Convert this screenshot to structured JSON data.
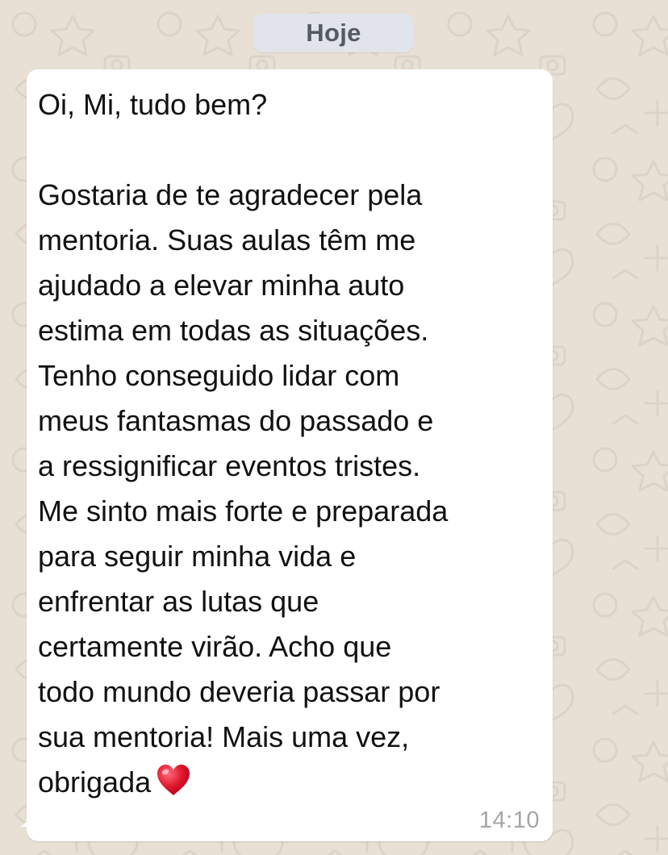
{
  "chat": {
    "date_divider": "Hoje",
    "message": {
      "lines": [
        "Oi, Mi, tudo bem?",
        "",
        "Gostaria de te agradecer pela",
        "mentoria. Suas aulas têm me",
        "ajudado a elevar minha auto",
        "estima em todas as situações.",
        "Tenho conseguido lidar com",
        "meus fantasmas do passado e",
        "a ressignificar eventos tristes.",
        "Me sinto mais forte e preparada",
        "para seguir minha vida e",
        "enfrentar as lutas que",
        "certamente virão. Acho que",
        "todo mundo deveria passar por",
        "sua mentoria! Mais uma vez,",
        "obrigada"
      ],
      "emoji": "red-heart-icon",
      "time": "14:10"
    }
  },
  "colors": {
    "wallpaper": "#e8e0d5",
    "bubble": "#ffffff",
    "date_pill": "#e1e4eb",
    "heart": "#e0182d"
  }
}
